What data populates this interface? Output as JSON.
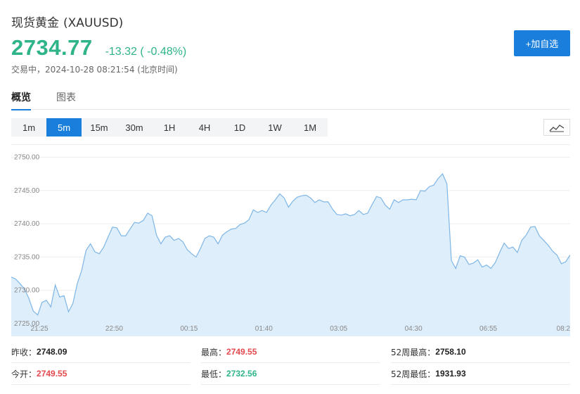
{
  "header": {
    "name": "现货黄金",
    "symbol": "(XAUUSD)",
    "price": "2734.77",
    "change": "-13.32 ( -0.48%)",
    "status": "交易中，2024-10-28 08:21:54 (北京时间)",
    "add_button": "+加自选"
  },
  "tabs": [
    {
      "label": "概览",
      "active": true
    },
    {
      "label": "图表",
      "active": false
    }
  ],
  "intervals": [
    "1m",
    "5m",
    "15m",
    "30m",
    "1H",
    "4H",
    "1D",
    "1W",
    "1M"
  ],
  "active_interval": "5m",
  "colors": {
    "up": "#e5484d",
    "down": "#2fb48a",
    "accent": "#1a7fdc",
    "line": "#7eb6e6",
    "fill": "#dfeefb"
  },
  "chart_data": {
    "type": "area",
    "ylim": [
      2725,
      2751
    ],
    "yticks": [
      "2725.00",
      "2730.00",
      "2735.00",
      "2740.00",
      "2745.00",
      "2750.00"
    ],
    "xticks": [
      "21:25",
      "22:50",
      "00:15",
      "01:40",
      "03:05",
      "04:30",
      "06:55",
      "08:2"
    ],
    "values": [
      2732,
      2731.7,
      2731,
      2730.2,
      2728.8,
      2726.9,
      2726.3,
      2728.2,
      2728.5,
      2727.5,
      2730.8,
      2729,
      2729.2,
      2726.8,
      2728,
      2731,
      2733,
      2736,
      2737,
      2735.8,
      2735.5,
      2736.5,
      2738,
      2739.5,
      2739.4,
      2738.2,
      2738.2,
      2739.2,
      2740.2,
      2740.1,
      2740.5,
      2741.6,
      2741.2,
      2738.3,
      2737,
      2738,
      2738.2,
      2737.5,
      2737.8,
      2737.3,
      2736.1,
      2735.5,
      2735,
      2736.3,
      2737.8,
      2738.2,
      2738,
      2737,
      2738.3,
      2738.8,
      2739.2,
      2739.3,
      2739.9,
      2740.1,
      2740.6,
      2742.1,
      2741.7,
      2742,
      2741.7,
      2742.8,
      2743.6,
      2744.5,
      2743.9,
      2742.5,
      2743.4,
      2744,
      2744.2,
      2744.3,
      2743.9,
      2743.2,
      2743.6,
      2743.3,
      2743.3,
      2742.2,
      2741.4,
      2741.3,
      2741.5,
      2741.2,
      2741.4,
      2742,
      2741.4,
      2741.6,
      2742.9,
      2744.1,
      2743.9,
      2742.8,
      2742.2,
      2743.6,
      2743.2,
      2743.6,
      2743.6,
      2743.7,
      2743.6,
      2745,
      2744.9,
      2745.6,
      2745.8,
      2746.8,
      2747.5,
      2746,
      2734.5,
      2733.3,
      2735.2,
      2735,
      2733.9,
      2734.1,
      2734.6,
      2733.5,
      2733.8,
      2733.3,
      2734.2,
      2735.7,
      2737.1,
      2736.3,
      2736.5,
      2735.7,
      2737.5,
      2738.3,
      2739.5,
      2739.6,
      2738.2,
      2737.5,
      2736.8,
      2735.9,
      2735.3,
      2734,
      2734.3,
      2735.3
    ]
  },
  "stats": {
    "prev_close_label": "昨收：",
    "prev_close": "2748.09",
    "high_label": "最高：",
    "high": "2749.55",
    "week52_high_label": "52周最高：",
    "week52_high": "2758.10",
    "open_label": "今开：",
    "open": "2749.55",
    "low_label": "最低：",
    "low": "2732.56",
    "week52_low_label": "52周最低：",
    "week52_low": "1931.93"
  }
}
